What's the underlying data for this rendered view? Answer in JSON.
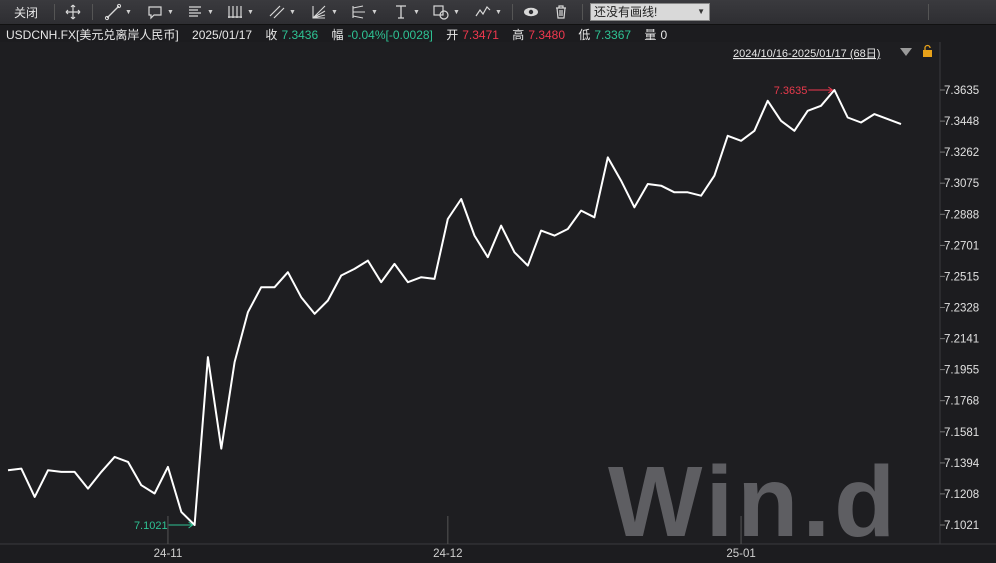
{
  "toolbar": {
    "close_label": "关闭",
    "drawing_select_value": "还没有画线!"
  },
  "info": {
    "symbol": "USDCNH.FX[美元兑离岸人民币]",
    "date": "2025/01/17",
    "close_label": "收",
    "close_value": "7.3436",
    "change_label": "幅",
    "change_value": "-0.04%[-0.0028]",
    "open_label": "开",
    "open_value": "7.3471",
    "high_label": "高",
    "high_value": "7.3480",
    "low_label": "低",
    "low_value": "7.3367",
    "volume_label": "量",
    "volume_value": "0"
  },
  "range": {
    "label": "2024/10/16-2025/01/17 (68日)"
  },
  "watermark": "Win.d",
  "colors": {
    "background": "#1c1c1f",
    "line": "#ffffff",
    "up": "#f0384e",
    "down": "#2ec394"
  },
  "chart_data": {
    "type": "line",
    "title": "",
    "xlabel": "",
    "ylabel": "",
    "ylim": [
      7.1021,
      7.3635
    ],
    "y_ticks": [
      "7.3635",
      "7.3448",
      "7.3262",
      "7.3075",
      "7.2888",
      "7.2701",
      "7.2515",
      "7.2328",
      "7.2141",
      "7.1955",
      "7.1768",
      "7.1581",
      "7.1394",
      "7.1208",
      "7.1021"
    ],
    "x_ticks": [
      {
        "label": "24-11",
        "index": 12
      },
      {
        "label": "24-12",
        "index": 33
      },
      {
        "label": "25-01",
        "index": 55
      }
    ],
    "annotations": {
      "max": {
        "label": "7.3635",
        "index": 62,
        "value": 7.3635
      },
      "min": {
        "label": "7.1021",
        "index": 14,
        "value": 7.1021
      }
    },
    "series": [
      {
        "values": [
          7.135,
          7.136,
          7.119,
          7.135,
          7.134,
          7.134,
          7.124,
          7.134,
          7.143,
          7.14,
          7.126,
          7.121,
          7.137,
          7.11,
          7.1021,
          7.203,
          7.148,
          7.2,
          7.23,
          7.245,
          7.245,
          7.254,
          7.239,
          7.229,
          7.237,
          7.252,
          7.256,
          7.261,
          7.248,
          7.259,
          7.248,
          7.251,
          7.25,
          7.286,
          7.298,
          7.276,
          7.263,
          7.282,
          7.266,
          7.258,
          7.279,
          7.276,
          7.28,
          7.291,
          7.287,
          7.323,
          7.309,
          7.293,
          7.307,
          7.306,
          7.302,
          7.302,
          7.3,
          7.312,
          7.336,
          7.333,
          7.339,
          7.357,
          7.345,
          7.339,
          7.351,
          7.354,
          7.3635,
          7.347,
          7.344,
          7.349,
          7.346,
          7.343
        ]
      }
    ]
  }
}
